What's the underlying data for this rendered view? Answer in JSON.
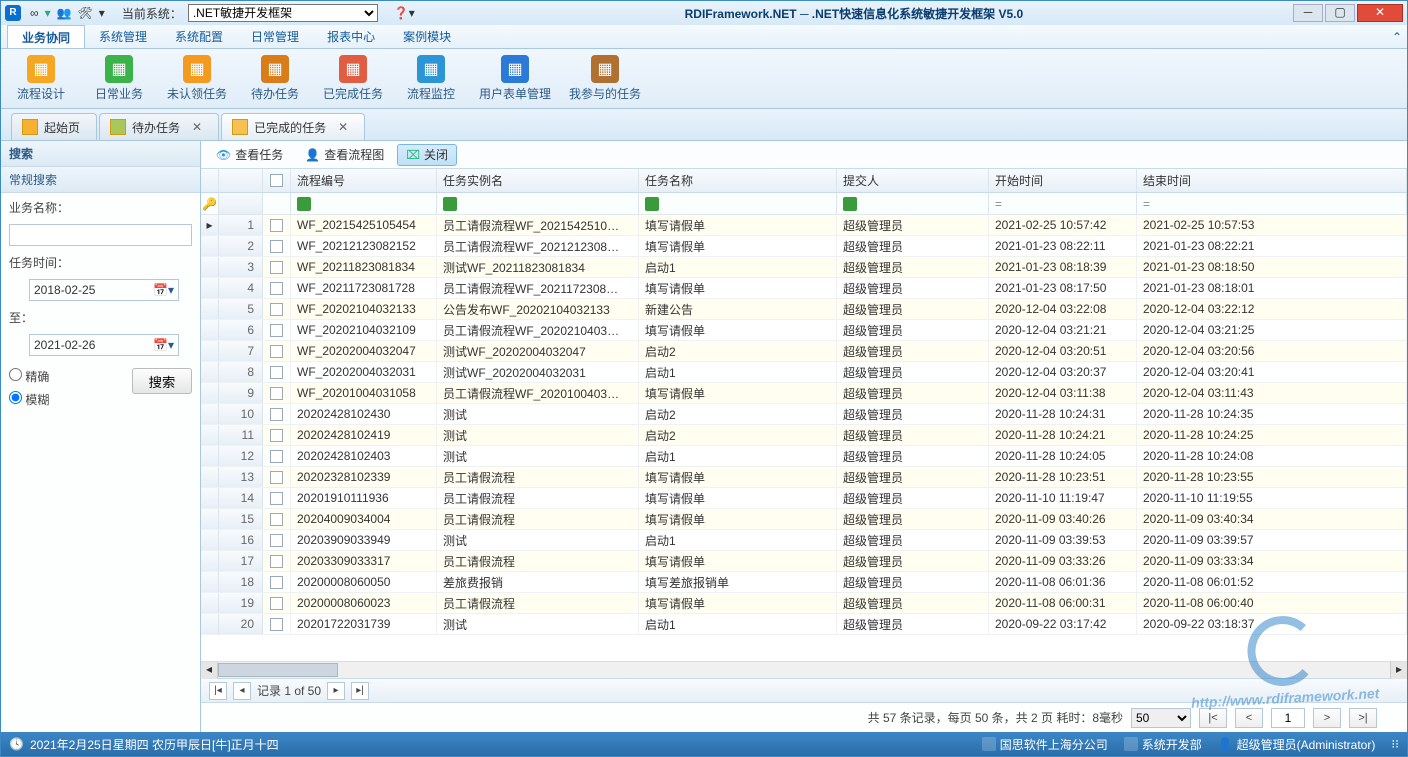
{
  "title": "RDIFramework.NET ─ .NET快速信息化系统敏捷开发框架 V5.0",
  "current_sys_label": "当前系统：",
  "current_sys_value": ".NET敏捷开发框架",
  "menus": [
    "业务协同",
    "系统管理",
    "系统配置",
    "日常管理",
    "报表中心",
    "案例模块"
  ],
  "ribbon": [
    {
      "label": "流程设计",
      "color": "#f5a623"
    },
    {
      "label": "日常业务",
      "color": "#3bb24a"
    },
    {
      "label": "未认领任务",
      "color": "#f49b1f"
    },
    {
      "label": "待办任务",
      "color": "#d97d1a"
    },
    {
      "label": "已完成任务",
      "color": "#e05d44"
    },
    {
      "label": "流程监控",
      "color": "#2b95d6"
    },
    {
      "label": "用户表单管理",
      "color": "#2b7bd6"
    },
    {
      "label": "我参与的任务",
      "color": "#b07030"
    }
  ],
  "tabs": [
    {
      "label": "起始页",
      "closable": false,
      "icon": "home"
    },
    {
      "label": "待办任务",
      "closable": true,
      "icon": "todo"
    },
    {
      "label": "已完成的任务",
      "closable": true,
      "icon": "done"
    }
  ],
  "sidebar": {
    "title": "搜索",
    "section": "常规搜索",
    "name_label": "业务名称：",
    "time_label": "任务时间：",
    "date_from": "2018-02-25",
    "to_label": "至：",
    "date_to": "2021-02-26",
    "radio_exact": "精确",
    "radio_fuzzy": "模糊",
    "search_btn": "搜索"
  },
  "toolbar2": {
    "view_task": "查看任务",
    "view_flow": "查看流程图",
    "close": "关闭"
  },
  "cols": {
    "code": "流程编号",
    "inst": "任务实例名",
    "task": "任务名称",
    "sub": "提交人",
    "start": "开始时间",
    "end": "结束时间"
  },
  "rows": [
    {
      "i": 1,
      "code": "WF_20215425105454",
      "inst": "员工请假流程WF_2021542510…",
      "task": "填写请假单",
      "sub": "超级管理员",
      "start": "2021-02-25 10:57:42",
      "end": "2021-02-25 10:57:53"
    },
    {
      "i": 2,
      "code": "WF_20212123082152",
      "inst": "员工请假流程WF_2021212308…",
      "task": "填写请假单",
      "sub": "超级管理员",
      "start": "2021-01-23 08:22:11",
      "end": "2021-01-23 08:22:21"
    },
    {
      "i": 3,
      "code": "WF_20211823081834",
      "inst": "测试WF_20211823081834",
      "task": "启动1",
      "sub": "超级管理员",
      "start": "2021-01-23 08:18:39",
      "end": "2021-01-23 08:18:50"
    },
    {
      "i": 4,
      "code": "WF_20211723081728",
      "inst": "员工请假流程WF_2021172308…",
      "task": "填写请假单",
      "sub": "超级管理员",
      "start": "2021-01-23 08:17:50",
      "end": "2021-01-23 08:18:01"
    },
    {
      "i": 5,
      "code": "WF_20202104032133",
      "inst": "公告发布WF_20202104032133",
      "task": "新建公告",
      "sub": "超级管理员",
      "start": "2020-12-04 03:22:08",
      "end": "2020-12-04 03:22:12"
    },
    {
      "i": 6,
      "code": "WF_20202104032109",
      "inst": "员工请假流程WF_2020210403…",
      "task": "填写请假单",
      "sub": "超级管理员",
      "start": "2020-12-04 03:21:21",
      "end": "2020-12-04 03:21:25"
    },
    {
      "i": 7,
      "code": "WF_20202004032047",
      "inst": "测试WF_20202004032047",
      "task": "启动2",
      "sub": "超级管理员",
      "start": "2020-12-04 03:20:51",
      "end": "2020-12-04 03:20:56"
    },
    {
      "i": 8,
      "code": "WF_20202004032031",
      "inst": "测试WF_20202004032031",
      "task": "启动1",
      "sub": "超级管理员",
      "start": "2020-12-04 03:20:37",
      "end": "2020-12-04 03:20:41"
    },
    {
      "i": 9,
      "code": "WF_20201004031058",
      "inst": "员工请假流程WF_2020100403…",
      "task": "填写请假单",
      "sub": "超级管理员",
      "start": "2020-12-04 03:11:38",
      "end": "2020-12-04 03:11:43"
    },
    {
      "i": 10,
      "code": "20202428102430",
      "inst": "测试",
      "task": "启动2",
      "sub": "超级管理员",
      "start": "2020-11-28 10:24:31",
      "end": "2020-11-28 10:24:35"
    },
    {
      "i": 11,
      "code": "20202428102419",
      "inst": "测试",
      "task": "启动2",
      "sub": "超级管理员",
      "start": "2020-11-28 10:24:21",
      "end": "2020-11-28 10:24:25"
    },
    {
      "i": 12,
      "code": "20202428102403",
      "inst": "测试",
      "task": "启动1",
      "sub": "超级管理员",
      "start": "2020-11-28 10:24:05",
      "end": "2020-11-28 10:24:08"
    },
    {
      "i": 13,
      "code": "20202328102339",
      "inst": "员工请假流程",
      "task": "填写请假单",
      "sub": "超级管理员",
      "start": "2020-11-28 10:23:51",
      "end": "2020-11-28 10:23:55"
    },
    {
      "i": 14,
      "code": "20201910111936",
      "inst": "员工请假流程",
      "task": "填写请假单",
      "sub": "超级管理员",
      "start": "2020-11-10 11:19:47",
      "end": "2020-11-10 11:19:55"
    },
    {
      "i": 15,
      "code": "20204009034004",
      "inst": "员工请假流程",
      "task": "填写请假单",
      "sub": "超级管理员",
      "start": "2020-11-09 03:40:26",
      "end": "2020-11-09 03:40:34"
    },
    {
      "i": 16,
      "code": "20203909033949",
      "inst": "测试",
      "task": "启动1",
      "sub": "超级管理员",
      "start": "2020-11-09 03:39:53",
      "end": "2020-11-09 03:39:57"
    },
    {
      "i": 17,
      "code": "20203309033317",
      "inst": "员工请假流程",
      "task": "填写请假单",
      "sub": "超级管理员",
      "start": "2020-11-09 03:33:26",
      "end": "2020-11-09 03:33:34"
    },
    {
      "i": 18,
      "code": "20200008060050",
      "inst": "差旅费报销",
      "task": "填写差旅报销单",
      "sub": "超级管理员",
      "start": "2020-11-08 06:01:36",
      "end": "2020-11-08 06:01:52"
    },
    {
      "i": 19,
      "code": "20200008060023",
      "inst": "员工请假流程",
      "task": "填写请假单",
      "sub": "超级管理员",
      "start": "2020-11-08 06:00:31",
      "end": "2020-11-08 06:00:40"
    },
    {
      "i": 20,
      "code": "20201722031739",
      "inst": "测试",
      "task": "启动1",
      "sub": "超级管理员",
      "start": "2020-09-22 03:17:42",
      "end": "2020-09-22 03:18:37"
    }
  ],
  "gridfoot": {
    "record": "记录 1 of 50"
  },
  "pager": {
    "text": "共 57 条记录，每页 50 条，共 2 页  耗时：8毫秒",
    "size": "50",
    "page": "1"
  },
  "status": {
    "date": "2021年2月25日星期四 农历甲辰日[牛]正月十四",
    "company": "国思软件上海分公司",
    "dept": "系统开发部",
    "user": "超级管理员(Administrator)"
  },
  "watermark": "http://www.rdiframework.net"
}
